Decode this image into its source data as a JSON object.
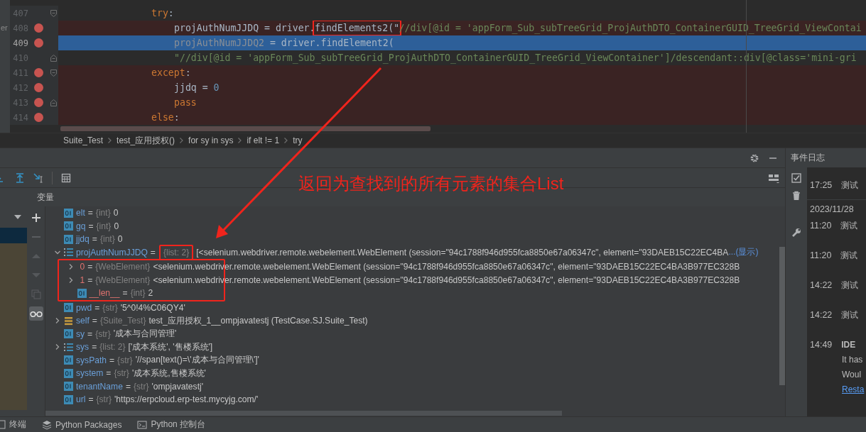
{
  "editor": {
    "side_label": "er",
    "lines": [
      {
        "number": "407",
        "breakpoint": false,
        "current": false,
        "fold_start": true,
        "fold_end": false,
        "indented": false,
        "tokens": [
          {
            "text": "try",
            "kind": "keyword"
          },
          {
            "text": ":",
            "kind": "plain"
          }
        ]
      },
      {
        "number": "408",
        "breakpoint": true,
        "current": false,
        "fold_start": false,
        "fold_end": false,
        "indented": true,
        "tokens": [
          {
            "text": "projAuthNumJJDQ = driver.",
            "kind": "plain"
          },
          {
            "text": "findElements2(\"",
            "kind": "plain",
            "highlighted": true
          },
          {
            "text": "//div[@id = 'appForm_Sub_subTreeGrid_ProjAuthDTO_ContainerGUID_TreeGrid_ViewContai",
            "kind": "string"
          }
        ]
      },
      {
        "number": "409",
        "breakpoint": true,
        "current": true,
        "fold_start": false,
        "fold_end": false,
        "indented": true,
        "tokens": [
          {
            "text": "projAuthNumJJDQ2",
            "kind": "unused"
          },
          {
            "text": " = driver.findElement2(",
            "kind": "plain"
          }
        ]
      },
      {
        "number": "410",
        "breakpoint": false,
        "current": false,
        "fold_start": false,
        "fold_end": true,
        "indented": true,
        "tokens": [
          {
            "text": "\"//div[@id = 'appForm_Sub_subTreeGrid_ProjAuthDTO_ContainerGUID_TreeGrid_ViewContainer']/descendant::div[@class='mini-gri",
            "kind": "string"
          }
        ]
      },
      {
        "number": "411",
        "breakpoint": true,
        "current": false,
        "fold_start": true,
        "fold_end": false,
        "indented": false,
        "tokens": [
          {
            "text": "except",
            "kind": "keyword"
          },
          {
            "text": ":",
            "kind": "plain"
          }
        ]
      },
      {
        "number": "412",
        "breakpoint": true,
        "current": false,
        "fold_start": false,
        "fold_end": false,
        "indented": true,
        "tokens": [
          {
            "text": "jjdq = ",
            "kind": "plain"
          },
          {
            "text": "0",
            "kind": "number"
          }
        ]
      },
      {
        "number": "413",
        "breakpoint": true,
        "current": false,
        "fold_start": false,
        "fold_end": true,
        "indented": true,
        "tokens": [
          {
            "text": "pass",
            "kind": "keyword"
          }
        ]
      },
      {
        "number": "414",
        "breakpoint": true,
        "current": false,
        "fold_start": false,
        "fold_end": false,
        "indented": false,
        "tokens": [
          {
            "text": "else",
            "kind": "keyword"
          },
          {
            "text": ":",
            "kind": "plain"
          }
        ]
      }
    ]
  },
  "breadcrumb": [
    "Suite_Test",
    "test_应用授权()",
    "for sy in sys",
    "if elt != 1",
    "try"
  ],
  "event_log": {
    "title": "事件日志",
    "items": [
      {
        "kind": "entry",
        "time": "17:25",
        "text": "测试"
      },
      {
        "kind": "date",
        "text": "2023/11/28"
      },
      {
        "kind": "entry",
        "time": "11:20",
        "text": "测试"
      },
      {
        "kind": "entry",
        "time": "11:20",
        "text": "测试"
      },
      {
        "kind": "entry",
        "time": "14:22",
        "text": "测试"
      },
      {
        "kind": "entry",
        "time": "14:22",
        "text": "测试"
      },
      {
        "kind": "notice",
        "time": "14:49",
        "title": "IDE",
        "lines": [
          "It has",
          "Woul"
        ],
        "link": "Resta"
      }
    ]
  },
  "variables": {
    "title": "变量",
    "items": [
      {
        "name": "elt",
        "eq": "=",
        "type": "{int}",
        "value": "0",
        "kind": "int"
      },
      {
        "name": "gq",
        "eq": "=",
        "type": "{int}",
        "value": "0",
        "kind": "int"
      },
      {
        "name": "jjdq",
        "eq": "=",
        "type": "{int}",
        "value": "0",
        "kind": "int"
      },
      {
        "name": "projAuthNumJJDQ",
        "eq": "=",
        "type": "{list: 2}",
        "value": "[<selenium.webdriver.remote.webelement.WebElement (session=\"94c1788f946d955fca8850e67a06347c\", element=\"93DAEB15C22EC4BA",
        "more": "...(显示)",
        "kind": "list",
        "expanded": true,
        "type_highlighted": true,
        "children_highlighted": true,
        "children": [
          {
            "name": "0",
            "eq": "=",
            "type": "{WebElement}",
            "value": "<selenium.webdriver.remote.webelement.WebElement (session=\"94c1788f946d955fca8850e67a06347c\", element=\"93DAEB15C22EC4BA3B977EC328B",
            "kind": "object",
            "expanded": false
          },
          {
            "name": "1",
            "eq": "=",
            "type": "{WebElement}",
            "value": "<selenium.webdriver.remote.webelement.WebElement (session=\"94c1788f946d955fca8850e67a06347c\", element=\"93DAEB15C22EC4BA3B977EC328B",
            "kind": "object",
            "expanded": false
          },
          {
            "name": "__len__",
            "eq": "=",
            "type": "{int}",
            "value": "2",
            "kind": "int"
          }
        ]
      },
      {
        "name": "pwd",
        "eq": "=",
        "type": "{str}",
        "value": "'5^0!4%C06QY4'",
        "kind": "int"
      },
      {
        "name": "self",
        "eq": "=",
        "type": "{Suite_Test}",
        "value": "test_应用授权_1__ompjavatestj (TestCase.SJ.Suite_Test)",
        "kind": "object",
        "expanded": false
      },
      {
        "name": "sy",
        "eq": "=",
        "type": "{str}",
        "value": "'成本与合同管理'",
        "kind": "int"
      },
      {
        "name": "sys",
        "eq": "=",
        "type": "{list: 2}",
        "value": "['成本系统', '售楼系统']",
        "kind": "list",
        "expanded": false
      },
      {
        "name": "sysPath",
        "eq": "=",
        "type": "{str}",
        "value": "'//span[text()=\\'成本与合同管理\\']'",
        "kind": "int"
      },
      {
        "name": "system",
        "eq": "=",
        "type": "{str}",
        "value": "'成本系统,售楼系统'",
        "kind": "int"
      },
      {
        "name": "tenantName",
        "eq": "=",
        "type": "{str}",
        "value": "'ompjavatestj'",
        "kind": "int"
      },
      {
        "name": "url",
        "eq": "=",
        "type": "{str}",
        "value": "'https://erpcloud.erp-test.mycyjg.com/'",
        "kind": "int"
      }
    ]
  },
  "bottom_tabs": [
    {
      "label": "终端",
      "kind": "terminal"
    },
    {
      "label": "Python Packages",
      "kind": "packages"
    },
    {
      "label": "Python 控制台",
      "kind": "console"
    }
  ],
  "annotation": {
    "text": "返回为查找到的所有元素的集合List"
  }
}
